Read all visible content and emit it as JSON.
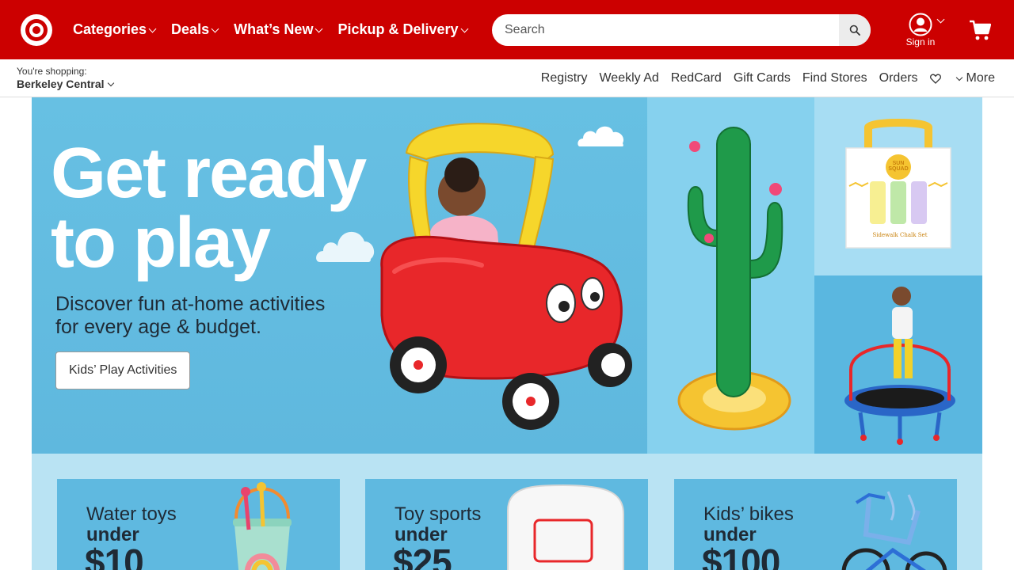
{
  "header": {
    "nav": [
      {
        "label": "Categories",
        "has_dropdown": true
      },
      {
        "label": "Deals",
        "has_dropdown": true
      },
      {
        "label": "What’s New",
        "has_dropdown": true
      },
      {
        "label": "Pickup & Delivery",
        "has_dropdown": true
      }
    ],
    "search": {
      "placeholder": "Search",
      "value": ""
    },
    "sign_in_label": "Sign in",
    "colors": {
      "brand_red": "#cc0000"
    }
  },
  "subheader": {
    "shopping_label": "You're shopping:",
    "store_name": "Berkeley Central",
    "links": [
      "Registry",
      "Weekly Ad",
      "RedCard",
      "Gift Cards",
      "Find Stores",
      "Orders"
    ],
    "more_label": "More"
  },
  "hero": {
    "title_line1": "Get ready",
    "title_line2": "to play",
    "subtitle_line1": "Discover fun at-home activities",
    "subtitle_line2": "for every age & budget.",
    "button_label": "Kids’ Play Activities",
    "chalk_box_text_1": "SUN SQUAD",
    "chalk_box_text_2": "Sidewalk Chalk Set"
  },
  "deals": [
    {
      "line1": "Water toys",
      "line2": "under",
      "line3": "$10"
    },
    {
      "line1": "Toy sports",
      "line2": "under",
      "line3": "$25"
    },
    {
      "line1": "Kids’ bikes",
      "line2": "under",
      "line3": "$100"
    }
  ]
}
